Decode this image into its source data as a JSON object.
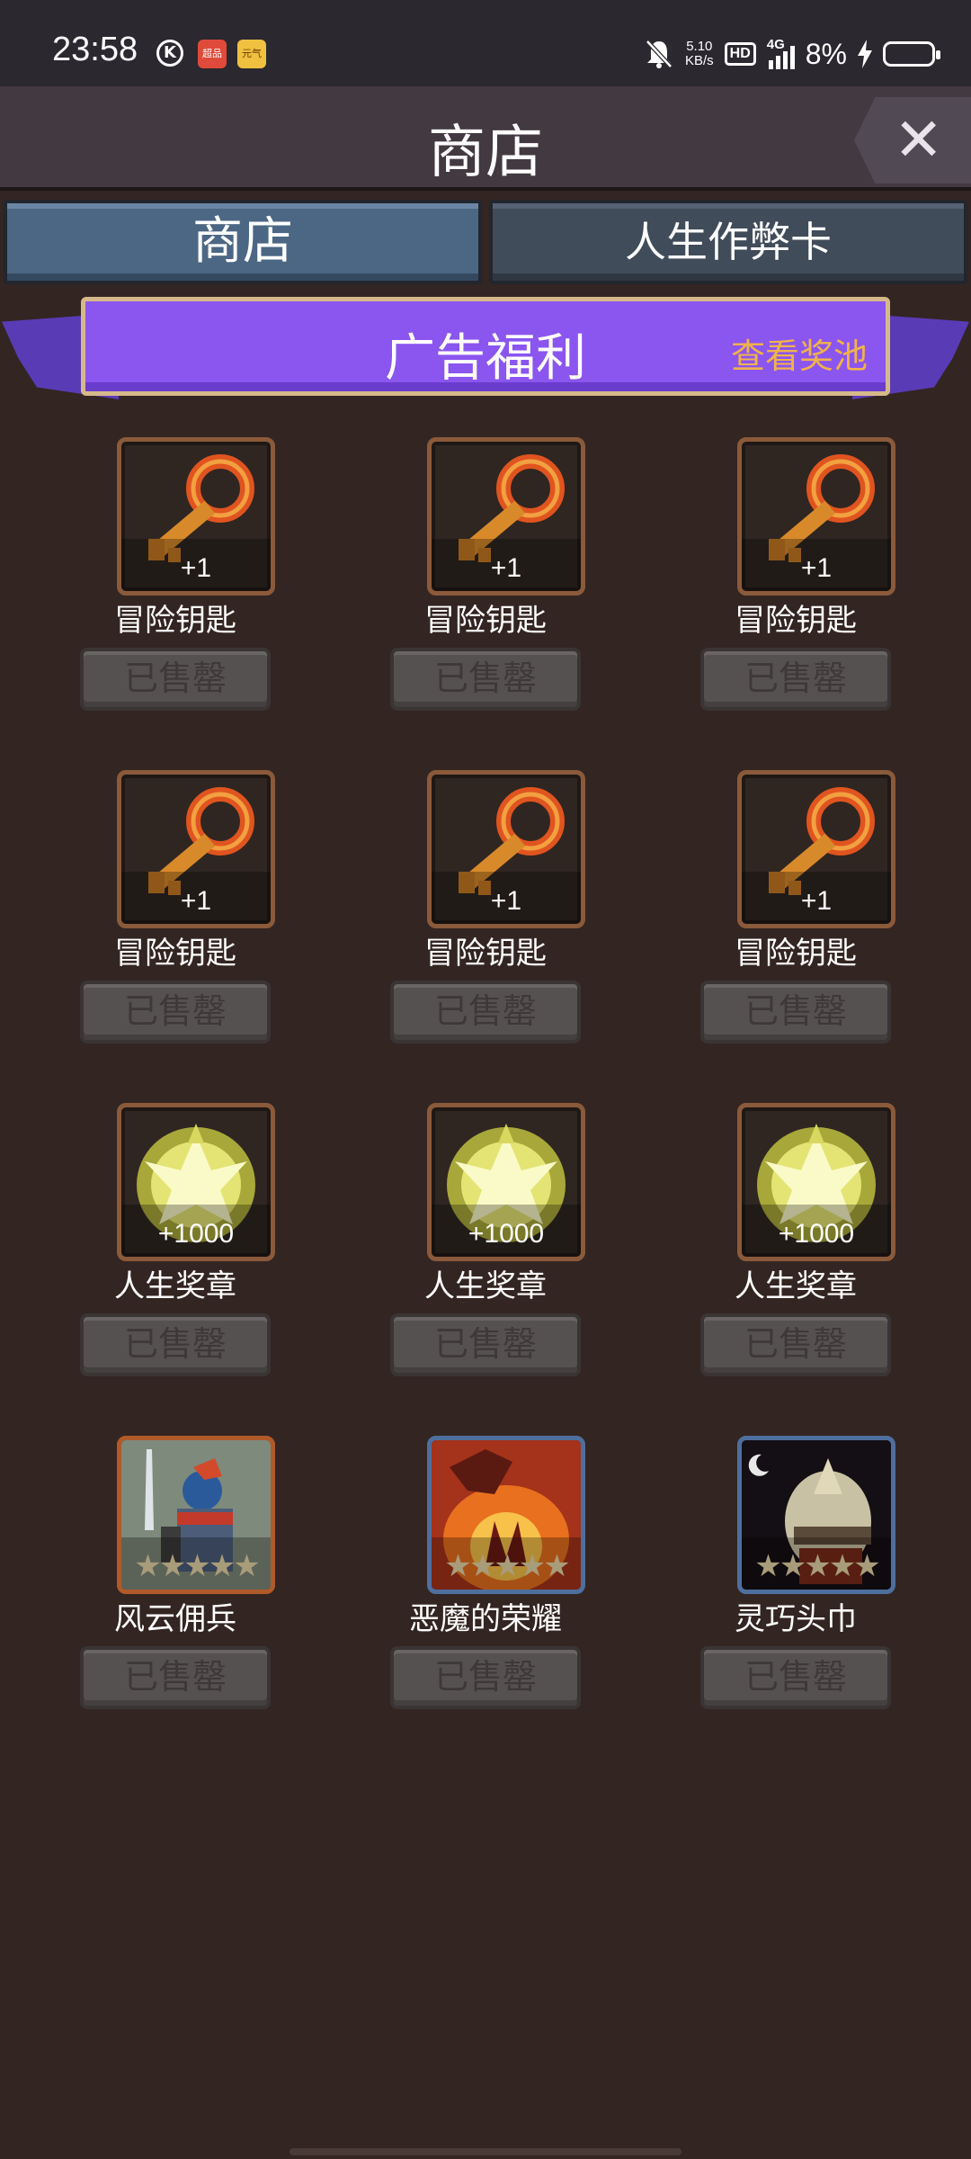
{
  "status_bar": {
    "time": "23:58",
    "k_icon_label": "K",
    "app_icon_1": "超品",
    "app_icon_2": "元气",
    "speed_value": "5.10",
    "speed_unit": "KB/s",
    "hd": "HD",
    "network": "4G",
    "battery_pct": "8%"
  },
  "header": {
    "title": "商店",
    "close_label": "✕"
  },
  "tabs": [
    {
      "label": "商店",
      "active": true
    },
    {
      "label": "人生作弊卡",
      "active": false
    }
  ],
  "banner": {
    "title": "广告福利",
    "link": "查看奖池"
  },
  "items": [
    {
      "name": "冒险钥匙",
      "qty": "+1",
      "icon": "key-icon",
      "button": "已售罄"
    },
    {
      "name": "冒险钥匙",
      "qty": "+1",
      "icon": "key-icon",
      "button": "已售罄"
    },
    {
      "name": "冒险钥匙",
      "qty": "+1",
      "icon": "key-icon",
      "button": "已售罄"
    },
    {
      "name": "冒险钥匙",
      "qty": "+1",
      "icon": "key-icon",
      "button": "已售罄"
    },
    {
      "name": "冒险钥匙",
      "qty": "+1",
      "icon": "key-icon",
      "button": "已售罄"
    },
    {
      "name": "冒险钥匙",
      "qty": "+1",
      "icon": "key-icon",
      "button": "已售罄"
    },
    {
      "name": "人生奖章",
      "qty": "+1000",
      "icon": "medal-icon",
      "button": "已售罄"
    },
    {
      "name": "人生奖章",
      "qty": "+1000",
      "icon": "medal-icon",
      "button": "已售罄"
    },
    {
      "name": "人生奖章",
      "qty": "+1000",
      "icon": "medal-icon",
      "button": "已售罄"
    },
    {
      "name": "风云佣兵",
      "stars": "★★★★★",
      "icon": "mercenary-portrait-icon",
      "button": "已售罄"
    },
    {
      "name": "恶魔的荣耀",
      "stars": "★★★★★",
      "icon": "demon-fire-icon",
      "button": "已售罄"
    },
    {
      "name": "灵巧头巾",
      "stars": "★★★★★",
      "icon": "helmet-icon",
      "button": "已售罄"
    }
  ],
  "colors": {
    "background": "#332522",
    "tab_active": "#4c6784",
    "banner": "#8b55ef",
    "banner_link": "#f0b24c",
    "sold_button": "#565151"
  }
}
